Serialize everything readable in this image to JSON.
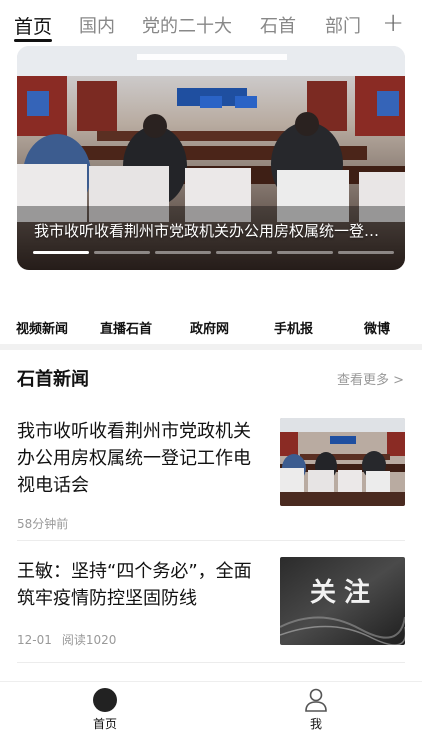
{
  "tabs": [
    "首页",
    "国内",
    "党的二十大",
    "石首",
    "部门"
  ],
  "add_label": "+",
  "banner": {
    "caption": "我市收听收看荆州市党政机关办公用房权属统一登记工作电视电话会",
    "slides": 6,
    "active_slide": 1
  },
  "quick_links": [
    "视频新闻",
    "直播石首",
    "政府网",
    "手机报",
    "微博"
  ],
  "section": {
    "title": "石首新闻",
    "more": "查看更多 >"
  },
  "news": [
    {
      "title": "我市收听收看荆州市党政机关办公用房权属统一登记工作电视电话会",
      "time": "58分钟前",
      "reads": ""
    },
    {
      "title": "王敏：坚持“四个务必”，全面筑牢疫情防控坚固防线",
      "time": "12-01",
      "reads": "阅读1020",
      "thumb_text": "关注"
    }
  ],
  "bottom_nav": [
    "首页",
    "我"
  ],
  "colors": {
    "accent": "#111111",
    "muted": "#999999"
  }
}
